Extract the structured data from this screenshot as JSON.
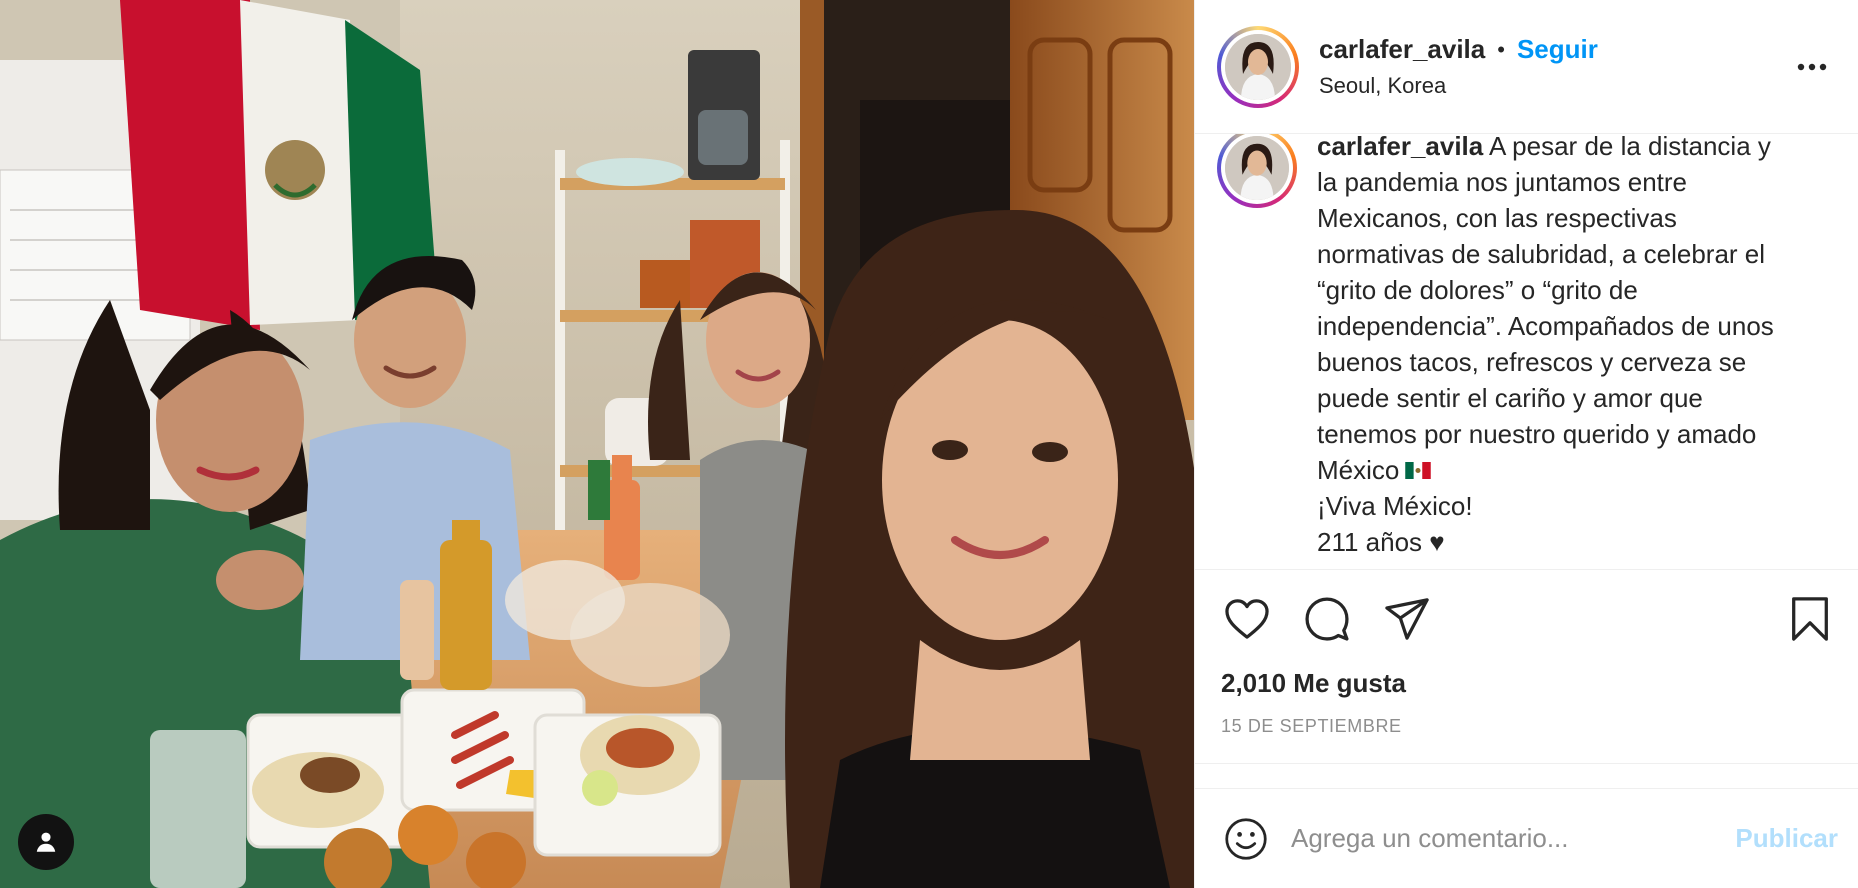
{
  "post": {
    "user_tag_icon": "person-icon"
  },
  "header": {
    "username": "carlafer_avila",
    "separator": "•",
    "follow_label": "Seguir",
    "location": "Seoul, Korea",
    "more_icon": "more-horizontal-icon"
  },
  "caption": {
    "username": "carlafer_avila",
    "lines": [
      "A pesar de la distancia y",
      "la pandemia nos juntamos entre",
      "Mexicanos, con las respectivas",
      "normativas de salubridad, a celebrar el",
      "“grito de dolores” o “grito de",
      "independencia”. Acompañados de unos",
      "buenos tacos, refrescos y cerveza se",
      "puede sentir el cariño y amor que",
      "tenemos por nuestro querido y amado",
      "México",
      "¡Viva México!",
      "211 años ♥"
    ],
    "emoji_icon": "mexico-flag-icon"
  },
  "actions": {
    "like_icon": "heart-icon",
    "comment_icon": "comment-icon",
    "share_icon": "paper-plane-icon",
    "save_icon": "bookmark-icon"
  },
  "likes": "2,010 Me gusta",
  "date": "15 DE SEPTIEMBRE",
  "comment_box": {
    "emoji_icon": "smiley-icon",
    "placeholder": "Agrega un comentario...",
    "value": "",
    "publish_label": "Publicar"
  },
  "colors": {
    "link_blue": "#0095f6",
    "publish_disabled": "#b2dffc",
    "muted": "#8e8e8e"
  }
}
